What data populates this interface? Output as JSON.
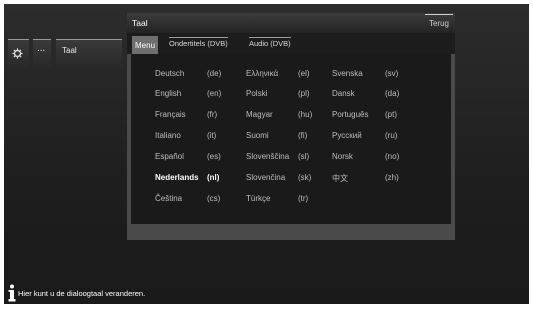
{
  "breadcrumb": {
    "items": [
      {
        "icon": "gear-icon"
      },
      {
        "label": "..."
      },
      {
        "label": "Taal"
      }
    ]
  },
  "panel": {
    "title": "Taal",
    "back_label": "Terug",
    "tabs": [
      {
        "label": "Menu",
        "active": true
      },
      {
        "label": "Ondertitels (DVB)",
        "active": false
      },
      {
        "label": "Audio (DVB)",
        "active": false
      }
    ]
  },
  "languages": [
    {
      "name": "Deutsch",
      "code": "(de)"
    },
    {
      "name": "English",
      "code": "(en)"
    },
    {
      "name": "Français",
      "code": "(fr)"
    },
    {
      "name": "Italiano",
      "code": "(it)"
    },
    {
      "name": "Español",
      "code": "(es)"
    },
    {
      "name": "Nederlands",
      "code": "(nl)",
      "selected": true
    },
    {
      "name": "Čeština",
      "code": "(cs)"
    },
    {
      "name": "Ελληνικά",
      "code": "(el)"
    },
    {
      "name": "Polski",
      "code": "(pl)"
    },
    {
      "name": "Magyar",
      "code": "(hu)"
    },
    {
      "name": "Suomi",
      "code": "(fi)"
    },
    {
      "name": "Slovenščina",
      "code": "(sl)"
    },
    {
      "name": "Slovenčina",
      "code": "(sk)"
    },
    {
      "name": "Türkçe",
      "code": "(tr)"
    },
    {
      "name": "Svenska",
      "code": "(sv)"
    },
    {
      "name": "Dansk",
      "code": "(da)"
    },
    {
      "name": "Português",
      "code": "(pt)"
    },
    {
      "name": "Русский",
      "code": "(ru)"
    },
    {
      "name": "Norsk",
      "code": "(no)"
    },
    {
      "name": "中文",
      "code": "(zh)"
    }
  ],
  "info": {
    "icon": "info-icon",
    "text": "Hier kunt u de dialoogtaal veranderen."
  },
  "colors": {
    "background": "#1e1e1e",
    "panel": "#4a4a4a",
    "active_tab": "#6f6f6f",
    "text": "#bdbdbd",
    "selected_text": "#ffffff"
  }
}
